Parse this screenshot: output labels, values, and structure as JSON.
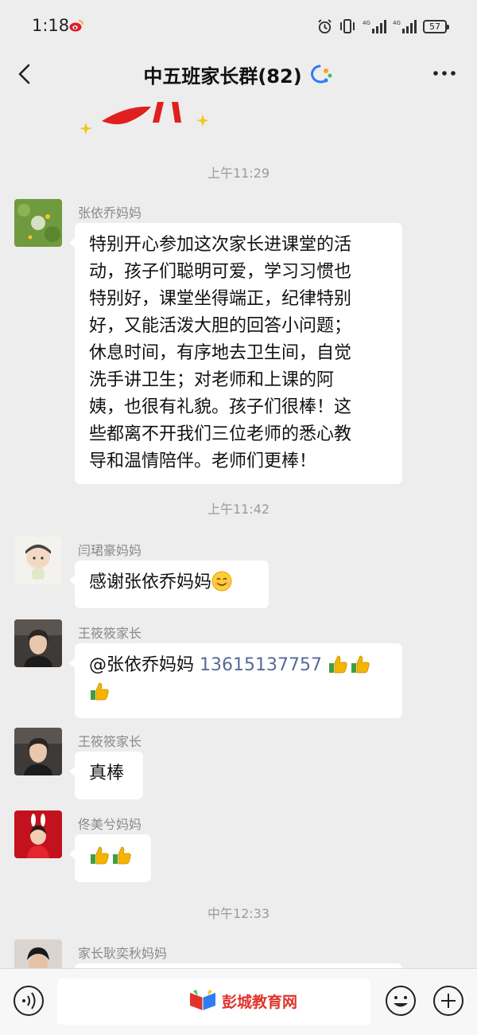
{
  "status_bar": {
    "time": "1:18",
    "battery": "57",
    "network_a": "4G",
    "network_b": "4G"
  },
  "header": {
    "title": "中五班家长群(82)"
  },
  "timestamps": [
    "上午11:29",
    "上午11:42",
    "中午12:33"
  ],
  "messages": [
    {
      "sender": "张依乔妈妈",
      "lines": [
        "特别开心参加这次家长进课堂的活",
        "动，孩子们聪明可爱，学习习惯也",
        "特别好，课堂坐得端正，纪律特别",
        "好，又能活泼大胆的回答小问题；",
        "休息时间，有序地去卫生间，自觉",
        "洗手讲卫生；对老师和上课的阿",
        "姨，也很有礼貌。孩子们很棒！这",
        "些都离不开我们三位老师的悉心教",
        "导和温情陪伴。老师们更棒！"
      ]
    },
    {
      "sender": "闫珺豪妈妈",
      "text": "感谢张依乔妈妈",
      "emoji": "smile-icon"
    },
    {
      "sender": "王筱筱家长",
      "mention": "@张依乔妈妈",
      "phone": "13615137757",
      "emoji": "thumbs-up-icon"
    },
    {
      "sender": "王筱筱家长",
      "text": "真棒"
    },
    {
      "sender": "佟美兮妈妈",
      "emoji": "thumbs-up-icon"
    },
    {
      "sender": "家长耿奕秋妈妈"
    }
  ],
  "bottom_bar": {
    "watermark": "彭城教育网"
  },
  "icons": [
    "weibo-icon",
    "alarm-icon",
    "vibrate-icon",
    "signal-icon",
    "battery-icon",
    "back-icon",
    "enterprise-icon",
    "more-icon",
    "voice-icon",
    "emoji-icon",
    "plus-icon"
  ],
  "colors": {
    "background": "#ededed",
    "bubble": "#ffffff",
    "link": "#576b95",
    "timestamp": "#9b9b9b"
  }
}
